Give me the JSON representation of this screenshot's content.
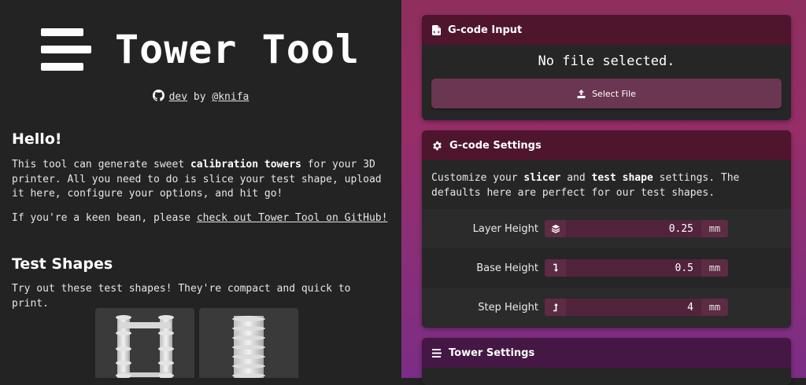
{
  "header": {
    "title": "Tower Tool",
    "branch_link": "dev",
    "by_text": "by",
    "author_link": "@knifa"
  },
  "hello": {
    "heading": "Hello!",
    "p1_a": "This tool can generate sweet ",
    "p1_b": "calibration towers",
    "p1_c": " for your 3D printer. All you need to do is slice your test shape, upload it here, configure your options, and hit go!",
    "p2_a": "If you're a keen bean, please ",
    "p2_link": "check out Tower Tool on GitHub!"
  },
  "test_shapes": {
    "heading": "Test Shapes",
    "description": "Try out these test shapes! They're compact and quick to print."
  },
  "gcode_input": {
    "title": "G-code Input",
    "status": "No file selected.",
    "button_label": "Select File"
  },
  "gcode_settings": {
    "title": "G-code Settings",
    "desc_a": "Customize your ",
    "desc_b": "slicer",
    "desc_c": " and ",
    "desc_d": "test shape",
    "desc_e": " settings. The defaults here are perfect for our test shapes.",
    "fields": [
      {
        "label": "Layer Height",
        "value": "0.25",
        "unit": "mm",
        "icon": "layers-icon"
      },
      {
        "label": "Base Height",
        "value": "0.5",
        "unit": "mm",
        "icon": "arrow-down-turn-icon"
      },
      {
        "label": "Step Height",
        "value": "4",
        "unit": "mm",
        "icon": "arrow-up-turn-icon"
      }
    ]
  },
  "tower_settings": {
    "title": "Tower Settings"
  },
  "colors": {
    "left_bg": "#232323",
    "panel_bg": "#262626",
    "panel_header": "#501430",
    "accent_button": "#6a3651",
    "input_bg": "#51243b"
  }
}
